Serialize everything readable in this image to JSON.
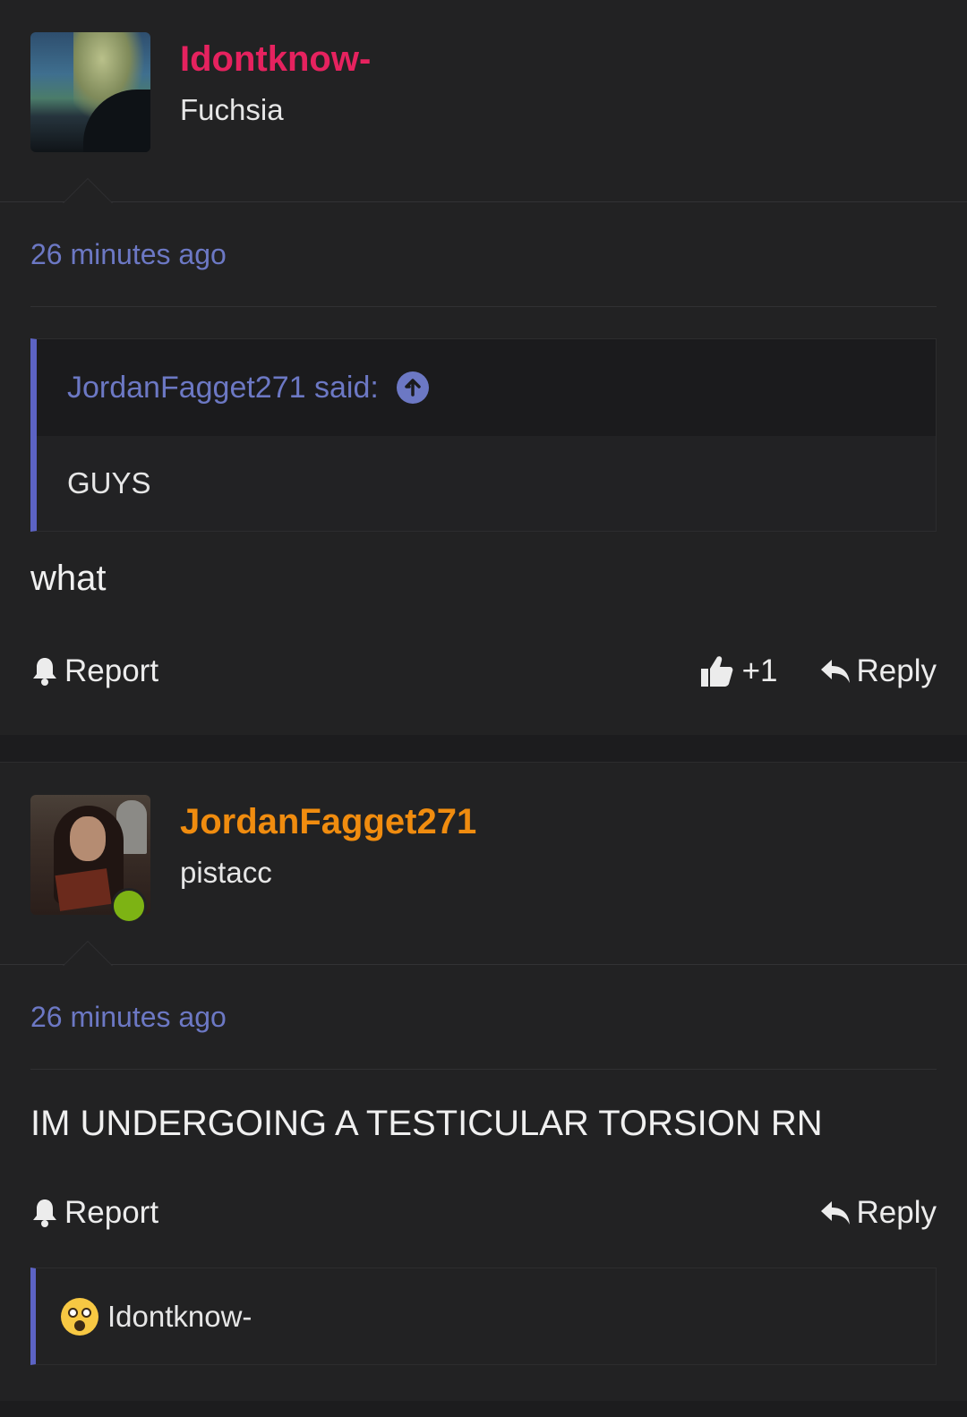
{
  "posts": [
    {
      "username": "Idontknow-",
      "username_color": "#e6225f",
      "user_title": "Fuchsia",
      "time": "26 minutes ago",
      "quote": {
        "author_label": "JordanFagget271 said:",
        "text": "GUYS"
      },
      "message": "what",
      "report_label": "Report",
      "reaction_count": "+1",
      "reply_label": "Reply"
    },
    {
      "username": "JordanFagget271",
      "username_color": "#f08c0f",
      "user_title": "pistacc",
      "online": true,
      "time": "26 minutes ago",
      "message": "IM UNDERGOING A TESTICULAR TORSION RN",
      "report_label": "Report",
      "reply_label": "Reply",
      "reactions_by": {
        "emoji": "astonished-face-icon",
        "user": "Idontknow-"
      }
    }
  ],
  "colors": {
    "accent": "#6c78c4",
    "quote_border": "#5c63c4",
    "online": "#7db314"
  }
}
